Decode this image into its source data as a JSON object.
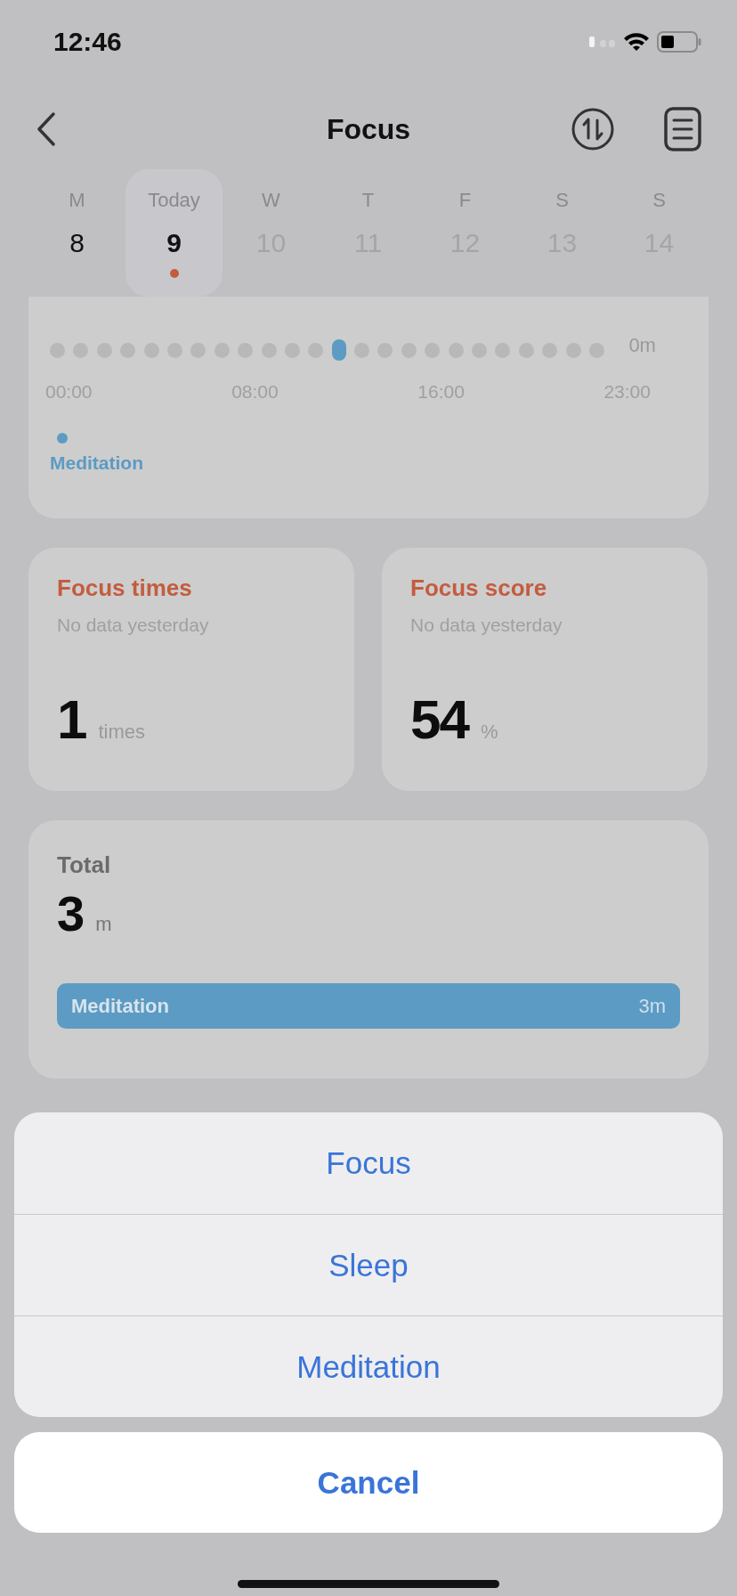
{
  "status_bar": {
    "time": "12:46"
  },
  "nav": {
    "title": "Focus"
  },
  "week": [
    {
      "weekday": "M",
      "date": "8",
      "selected": false,
      "disabled": false,
      "has_record": false
    },
    {
      "weekday": "Today",
      "date": "9",
      "selected": true,
      "disabled": false,
      "has_record": true
    },
    {
      "weekday": "W",
      "date": "10",
      "selected": false,
      "disabled": true,
      "has_record": false
    },
    {
      "weekday": "T",
      "date": "11",
      "selected": false,
      "disabled": true,
      "has_record": false
    },
    {
      "weekday": "F",
      "date": "12",
      "selected": false,
      "disabled": true,
      "has_record": false
    },
    {
      "weekday": "S",
      "date": "13",
      "selected": false,
      "disabled": true,
      "has_record": false
    },
    {
      "weekday": "S",
      "date": "14",
      "selected": false,
      "disabled": true,
      "has_record": false
    }
  ],
  "timeline": {
    "reading": "0m",
    "hours": [
      {
        "on": false
      },
      {
        "on": false
      },
      {
        "on": false
      },
      {
        "on": false
      },
      {
        "on": false
      },
      {
        "on": false
      },
      {
        "on": false
      },
      {
        "on": false
      },
      {
        "on": false
      },
      {
        "on": false
      },
      {
        "on": false
      },
      {
        "on": false
      },
      {
        "on": true
      },
      {
        "on": false
      },
      {
        "on": false
      },
      {
        "on": false
      },
      {
        "on": false
      },
      {
        "on": false
      },
      {
        "on": false
      },
      {
        "on": false
      },
      {
        "on": false
      },
      {
        "on": false
      },
      {
        "on": false
      },
      {
        "on": false
      }
    ],
    "axis_labels": [
      "00:00",
      "08:00",
      "16:00",
      "23:00"
    ],
    "legend": [
      {
        "label": "Meditation",
        "color": "#5b9bc4"
      }
    ]
  },
  "stats": [
    {
      "title": "Focus times",
      "subtitle": "No data yesterday",
      "value": "1",
      "unit": "times"
    },
    {
      "title": "Focus score",
      "subtitle": "No data yesterday",
      "value": "54",
      "unit": "%"
    }
  ],
  "total": {
    "label": "Total",
    "value": "3",
    "unit": "m",
    "bars": [
      {
        "label": "Meditation",
        "reading": "3m",
        "color": "#5b9bc4"
      }
    ]
  },
  "action_sheet": {
    "options": [
      "Focus",
      "Sleep",
      "Meditation"
    ],
    "cancel": "Cancel"
  }
}
